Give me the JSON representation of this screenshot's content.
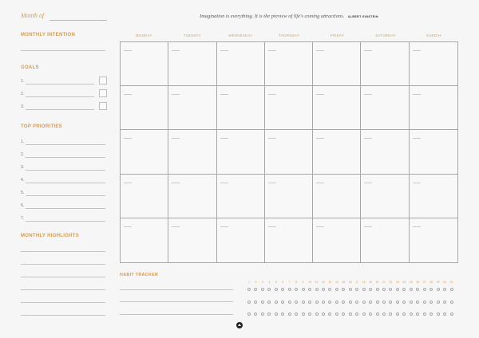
{
  "month_label": "Month of",
  "quote": {
    "text": "Imagination is everything. It is the preview of life's coming attractions.",
    "author": "ALBERT EINSTEIN"
  },
  "sections": {
    "monthly_intention": "MONTHLY INTENTION",
    "goals": "GOALS",
    "top_priorities": "TOP PRIORITIES",
    "monthly_highlights": "MONTHLY HIGHLIGHTS",
    "habit_tracker": "HABIT TRACKER"
  },
  "goals_numbers": [
    "1.",
    "2.",
    "3."
  ],
  "priority_numbers": [
    "1.",
    "2.",
    "3.",
    "4.",
    "5.",
    "6.",
    "7."
  ],
  "weekdays": [
    "MONDAY",
    "TUESDAY",
    "WEDNESDAY",
    "THURSDAY",
    "FRIDAY",
    "SATURDAY",
    "SUNDAY"
  ],
  "habit_days": [
    "1",
    "2",
    "3",
    "4",
    "5",
    "6",
    "7",
    "8",
    "9",
    "10",
    "11",
    "12",
    "13",
    "14",
    "15",
    "16",
    "17",
    "18",
    "19",
    "20",
    "21",
    "22",
    "23",
    "24",
    "25",
    "26",
    "27",
    "28",
    "29",
    "30",
    "31"
  ],
  "colors": {
    "accent": "#d39a55",
    "rule": "#c4c4c4",
    "grid": "#a8a8a8",
    "paper": "#f6f6f6"
  },
  "icons": {
    "logo": "triangle-mark-icon"
  }
}
